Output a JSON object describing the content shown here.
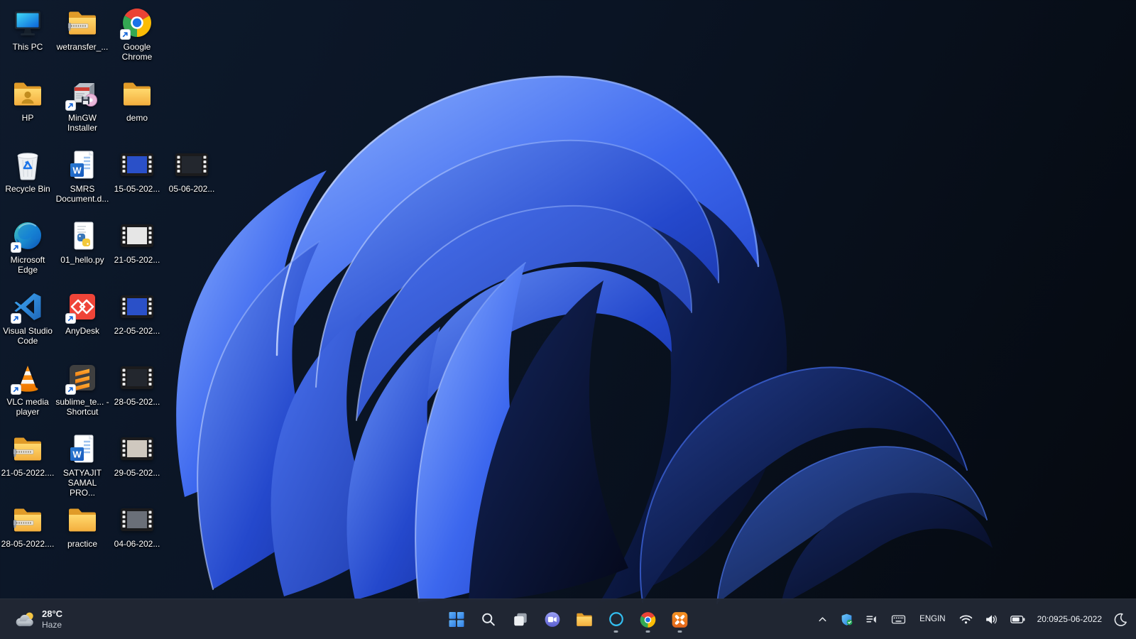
{
  "desktop": {
    "icons": [
      {
        "label": "This PC",
        "type": "this-pc",
        "col": 0,
        "row": 0,
        "shortcut": false
      },
      {
        "label": "wetransfer_...",
        "type": "zip-folder",
        "col": 1,
        "row": 0,
        "shortcut": false
      },
      {
        "label": "Google Chrome",
        "type": "chrome",
        "col": 2,
        "row": 0,
        "shortcut": true
      },
      {
        "label": "HP",
        "type": "user-folder",
        "col": 0,
        "row": 1,
        "shortcut": false
      },
      {
        "label": "MinGW Installer",
        "type": "installer",
        "col": 1,
        "row": 1,
        "shortcut": true
      },
      {
        "label": "demo",
        "type": "folder",
        "col": 2,
        "row": 1,
        "shortcut": false
      },
      {
        "label": "Recycle Bin",
        "type": "recycle-bin",
        "col": 0,
        "row": 2,
        "shortcut": false
      },
      {
        "label": "SMRS Document.d...",
        "type": "word-doc",
        "col": 1,
        "row": 2,
        "shortcut": false
      },
      {
        "label": "15-05-202...",
        "type": "video",
        "col": 2,
        "row": 2,
        "shortcut": false
      },
      {
        "label": "05-06-202...",
        "type": "video",
        "col": 3,
        "row": 2,
        "shortcut": false
      },
      {
        "label": "Microsoft Edge",
        "type": "edge",
        "col": 0,
        "row": 3,
        "shortcut": true
      },
      {
        "label": "01_hello.py",
        "type": "python-file",
        "col": 1,
        "row": 3,
        "shortcut": false
      },
      {
        "label": "21-05-202...",
        "type": "video",
        "col": 2,
        "row": 3,
        "shortcut": false
      },
      {
        "label": "Visual Studio Code",
        "type": "vscode",
        "col": 0,
        "row": 4,
        "shortcut": true
      },
      {
        "label": "AnyDesk",
        "type": "anydesk",
        "col": 1,
        "row": 4,
        "shortcut": true
      },
      {
        "label": "22-05-202...",
        "type": "video",
        "col": 2,
        "row": 4,
        "shortcut": false
      },
      {
        "label": "VLC media player",
        "type": "vlc",
        "col": 0,
        "row": 5,
        "shortcut": true
      },
      {
        "label": "sublime_te... - Shortcut",
        "type": "sublime",
        "col": 1,
        "row": 5,
        "shortcut": true
      },
      {
        "label": "28-05-202...",
        "type": "video",
        "col": 2,
        "row": 5,
        "shortcut": false
      },
      {
        "label": "21-05-2022....",
        "type": "zip-folder",
        "col": 0,
        "row": 6,
        "shortcut": false
      },
      {
        "label": "SATYAJIT SAMAL PRO...",
        "type": "word-doc",
        "col": 1,
        "row": 6,
        "shortcut": false
      },
      {
        "label": "29-05-202...",
        "type": "video",
        "col": 2,
        "row": 6,
        "shortcut": false
      },
      {
        "label": "28-05-2022....",
        "type": "zip-folder",
        "col": 0,
        "row": 7,
        "shortcut": false
      },
      {
        "label": "practice",
        "type": "folder",
        "col": 1,
        "row": 7,
        "shortcut": false
      },
      {
        "label": "04-06-202...",
        "type": "video",
        "col": 2,
        "row": 7,
        "shortcut": false
      }
    ]
  },
  "taskbar": {
    "widgets": {
      "temperature": "28°C",
      "condition": "Haze",
      "icon": "moon-cloud-icon"
    },
    "apps": [
      {
        "name": "start",
        "icon": "windows-start-icon",
        "running": false
      },
      {
        "name": "search",
        "icon": "search-icon",
        "running": false
      },
      {
        "name": "task-view",
        "icon": "task-view-icon",
        "running": false
      },
      {
        "name": "chat",
        "icon": "chat-video-icon",
        "running": false
      },
      {
        "name": "file-explorer",
        "icon": "folder-icon",
        "running": false
      },
      {
        "name": "alexa",
        "icon": "alexa-icon",
        "running": true
      },
      {
        "name": "chrome",
        "icon": "chrome-icon",
        "running": true
      },
      {
        "name": "xampp",
        "icon": "xampp-icon",
        "running": true
      }
    ],
    "tray": {
      "hidden_icons_chevron": "chevron-up-icon",
      "icons": [
        {
          "name": "windows-security",
          "icon": "shield-check-icon"
        },
        {
          "name": "volume-mixer",
          "icon": "volume-mixer-icon"
        },
        {
          "name": "touch-keyboard",
          "icon": "keyboard-icon"
        }
      ],
      "language": {
        "line1": "ENG",
        "line2": "IN"
      },
      "status": [
        {
          "name": "network",
          "icon": "wifi-icon"
        },
        {
          "name": "volume",
          "icon": "speaker-icon"
        },
        {
          "name": "battery",
          "icon": "battery-icon"
        }
      ],
      "clock": {
        "time": "20:09",
        "date": "25-06-2022"
      },
      "focus_assist": {
        "icon": "moon-icon"
      }
    }
  },
  "colors": {
    "taskbar_bg": "#212734",
    "bloom_bright": "#5b86f6",
    "bloom_deep": "#132a7e",
    "background_top": "#0e1a2c",
    "background_bottom": "#05090f",
    "folder_yellow": "#ffd96e",
    "shortcut_arrow_blue": "#1565d8"
  }
}
